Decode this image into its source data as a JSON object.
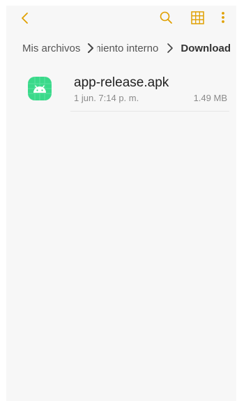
{
  "toolbar": {
    "accent_color": "#e0a000",
    "back_icon": "chevron-left-icon",
    "search_icon": "search-icon",
    "grid_icon": "grid-view-icon",
    "more_icon": "more-vertical-icon"
  },
  "breadcrumb": {
    "items": [
      {
        "label": "Mis archivos"
      },
      {
        "label": "Almacenamiento interno"
      },
      {
        "label": "Download"
      }
    ],
    "separator_icon": "chevron-right-icon"
  },
  "files": [
    {
      "name": "app-release.apk",
      "date": "1 jun. 7:14 p. m.",
      "size": "1.49 MB",
      "icon": "android-apk-icon",
      "icon_color": "#3ad98a"
    }
  ]
}
